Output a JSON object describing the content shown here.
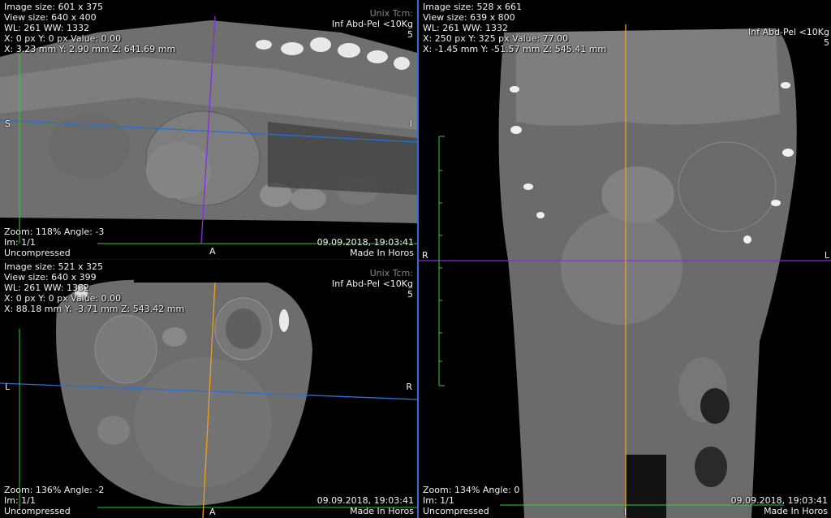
{
  "viewports": {
    "sagittal": {
      "image_size": "Image size: 601 x 375",
      "view_size": "View size: 640 x 400",
      "wl_ww": "WL: 261 WW: 1332",
      "pixel_value": "X: 0 px Y: 0 px Value: 0.00",
      "mm_coords": "X: 3.23 mm Y: 2.90 mm Z: 641.69 mm",
      "faint_label": "Unix Tcm:",
      "series_desc": "Inf Abd-Pel <10Kg",
      "series_num": "5",
      "zoom_angle": "Zoom: 118% Angle: -3",
      "image_index": "Im: 1/1",
      "compression": "Uncompressed",
      "datetime": "09.09.2018, 19:03:41",
      "made_in": "Made In Horos",
      "orient_left": "S",
      "orient_right": "I",
      "orient_bottom": "A",
      "crosshair_h_color": "#2a6fd6",
      "crosshair_v_color": "#8a2be2"
    },
    "axial": {
      "image_size": "Image size: 521 x 325",
      "view_size": "View size: 640 x 399",
      "wl_ww": "WL: 261 WW: 1332",
      "pixel_value": "X: 0 px Y: 0 px Value: 0.00",
      "mm_coords": "X: 88.18 mm Y: -3.71 mm Z: 543.42 mm",
      "faint_label": "Unix Tcm:",
      "series_desc": "Inf Abd-Pel <10Kg",
      "series_num": "5",
      "zoom_angle": "Zoom: 136% Angle: -2",
      "image_index": "Im: 1/1",
      "compression": "Uncompressed",
      "datetime": "09.09.2018, 19:03:41",
      "made_in": "Made In Horos",
      "orient_left": "L",
      "orient_right": "R",
      "orient_bottom": "A",
      "crosshair_h_color": "#2a6fd6",
      "crosshair_v_color": "#f0a020"
    },
    "coronal": {
      "image_size": "Image size: 528 x 661",
      "view_size": "View size: 639 x 800",
      "wl_ww": "WL: 261 WW: 1332",
      "pixel_value": "X: 250 px Y: 325 px Value: 77.00",
      "mm_coords": "X: -1.45 mm Y: -51.57 mm Z: 545.41 mm",
      "series_desc": "Inf Abd-Pel <10Kg",
      "series_num": "5",
      "zoom_angle": "Zoom: 134% Angle: 0",
      "image_index": "Im: 1/1",
      "compression": "Uncompressed",
      "datetime": "09.09.2018, 19:03:41",
      "made_in": "Made In Horos",
      "orient_left": "R",
      "orient_right": "L",
      "orient_bottom": "I",
      "crosshair_h_color": "#8a2be2",
      "crosshair_v_color": "#f0a020"
    }
  },
  "colors": {
    "active_border": "#2d6fd1",
    "scale_bar": "#33cc33"
  }
}
